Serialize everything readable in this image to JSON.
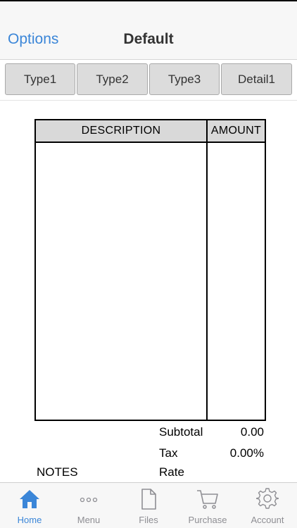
{
  "header": {
    "options_label": "Options",
    "title": "Default"
  },
  "segments": [
    {
      "label": "Type1"
    },
    {
      "label": "Type2"
    },
    {
      "label": "Type3"
    },
    {
      "label": "Detail1"
    }
  ],
  "table": {
    "col_description": "DESCRIPTION",
    "col_amount": "AMOUNT"
  },
  "totals": {
    "subtotal_label": "Subtotal",
    "subtotal_value": "0.00",
    "tax_label": "Tax",
    "tax_value": "0.00%",
    "rate_label": "Rate",
    "notes_label": "NOTES"
  },
  "tabbar": {
    "items": [
      {
        "label": "Home",
        "icon": "home-icon",
        "active": true
      },
      {
        "label": "Menu",
        "icon": "more-icon"
      },
      {
        "label": "Files",
        "icon": "file-icon"
      },
      {
        "label": "Purchase",
        "icon": "cart-icon"
      },
      {
        "label": "Account",
        "icon": "gear-icon"
      }
    ]
  },
  "colors": {
    "accent": "#3b86d8",
    "inactive": "#8e8e93"
  }
}
